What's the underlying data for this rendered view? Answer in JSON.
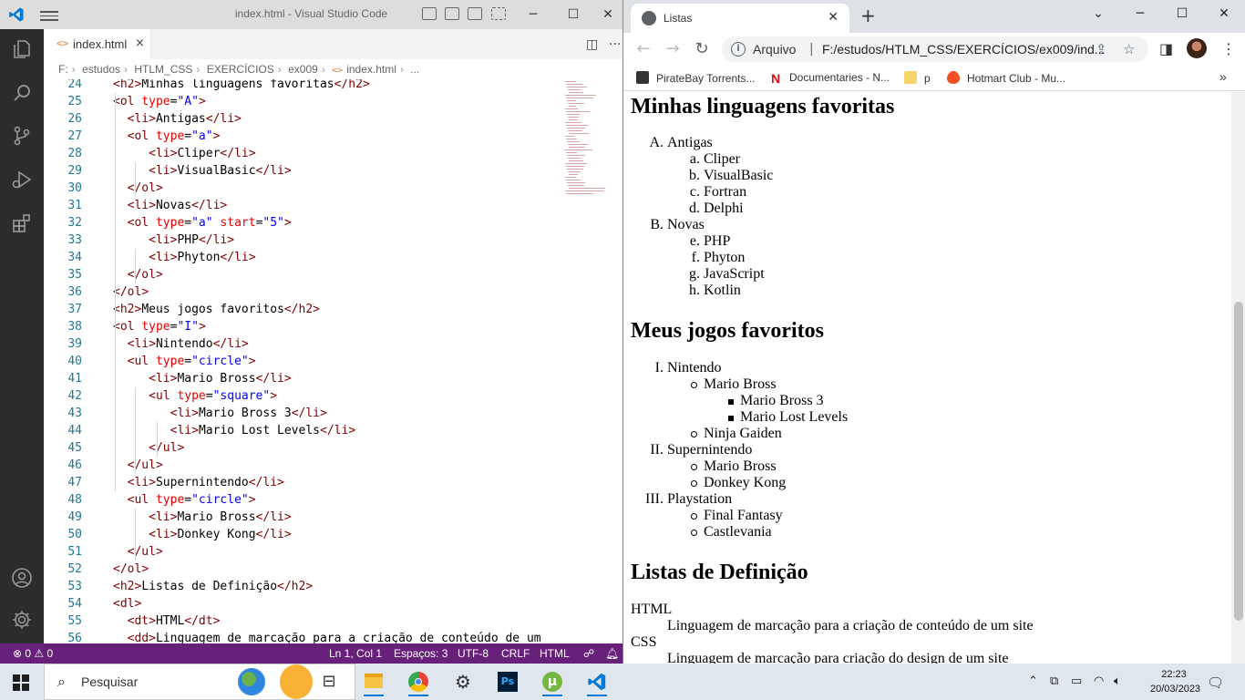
{
  "vscode": {
    "window_title": "index.html - Visual Studio Code",
    "tab": {
      "label": "index.html",
      "close": "×"
    },
    "breadcrumb": [
      "F:",
      "estudos",
      "HTLM_CSS",
      "EXERCÍCIOS",
      "ex009",
      "index.html",
      "..."
    ],
    "lines": [
      {
        "n": "24",
        "code": "<h2>Minhas linguagens favoritas</h2>"
      },
      {
        "n": "25",
        "code": "<ol type=\"A\">"
      },
      {
        "n": "26",
        "code": "  <li>Antigas</li>"
      },
      {
        "n": "27",
        "code": "  <ol type=\"a\">"
      },
      {
        "n": "28",
        "code": "     <li>Cliper</li>"
      },
      {
        "n": "29",
        "code": "     <li>VisualBasic</li>"
      },
      {
        "n": "30",
        "code": "  </ol>"
      },
      {
        "n": "31",
        "code": "  <li>Novas</li>"
      },
      {
        "n": "32",
        "code": "  <ol type=\"a\" start=\"5\">"
      },
      {
        "n": "33",
        "code": "     <li>PHP</li>"
      },
      {
        "n": "34",
        "code": "     <li>Phyton</li>"
      },
      {
        "n": "35",
        "code": "  </ol>"
      },
      {
        "n": "36",
        "code": "</ol>"
      },
      {
        "n": "37",
        "code": "<h2>Meus jogos favoritos</h2>"
      },
      {
        "n": "38",
        "code": "<ol type=\"I\">"
      },
      {
        "n": "39",
        "code": "  <li>Nintendo</li>"
      },
      {
        "n": "40",
        "code": "  <ul type=\"circle\">"
      },
      {
        "n": "41",
        "code": "     <li>Mario Bross</li>"
      },
      {
        "n": "42",
        "code": "     <ul type=\"square\">"
      },
      {
        "n": "43",
        "code": "        <li>Mario Bross 3</li>"
      },
      {
        "n": "44",
        "code": "        <li>Mario Lost Levels</li>"
      },
      {
        "n": "45",
        "code": "     </ul>"
      },
      {
        "n": "46",
        "code": "  </ul>"
      },
      {
        "n": "47",
        "code": "  <li>Supernintendo</li>"
      },
      {
        "n": "48",
        "code": "  <ul type=\"circle\">"
      },
      {
        "n": "49",
        "code": "     <li>Mario Bross</li>"
      },
      {
        "n": "50",
        "code": "     <li>Donkey Kong</li>"
      },
      {
        "n": "51",
        "code": "  </ul>"
      },
      {
        "n": "52",
        "code": "</ol>"
      },
      {
        "n": "53",
        "code": "<h2>Listas de Definição</h2>"
      },
      {
        "n": "54",
        "code": "<dl>"
      },
      {
        "n": "55",
        "code": "  <dt>HTML</dt>"
      },
      {
        "n": "56",
        "code": "  <dd>Linguagem de marcação para a criação de conteúdo de um"
      }
    ],
    "status": {
      "errors": "0",
      "warnings": "0",
      "position": "Ln 1, Col 1",
      "spaces": "Espaços: 3",
      "encoding": "UTF-8",
      "eol": "CRLF",
      "language": "HTML"
    },
    "colors": {
      "status_bar": "#68217a",
      "activity_bar": "#2c2c2c",
      "tag": "#800000",
      "attr": "#e50000",
      "value": "#0000ff"
    }
  },
  "chrome": {
    "tab_title": "Listas",
    "omnibox_label": "Arquivo",
    "url": "F:/estudos/HTLM_CSS/EXERCÍCIOS/ex009/ind...",
    "bookmarks": [
      {
        "label": "PirateBay Torrents...",
        "icon": "ship-icon"
      },
      {
        "label": "Documentaries - N...",
        "icon": "netflix-icon"
      },
      {
        "label": "p",
        "icon": "folder-icon"
      },
      {
        "label": "Hotmart Club - Mu...",
        "icon": "hotmart-icon"
      }
    ],
    "page": {
      "h_langs": "Minhas linguagens favoritas",
      "langs": [
        {
          "marker": "A.",
          "text": "Antigas",
          "level": 1
        },
        {
          "marker": "a.",
          "text": "Cliper",
          "level": 2
        },
        {
          "marker": "b.",
          "text": "VisualBasic",
          "level": 2
        },
        {
          "marker": "c.",
          "text": "Fortran",
          "level": 2
        },
        {
          "marker": "d.",
          "text": "Delphi",
          "level": 2
        },
        {
          "marker": "B.",
          "text": "Novas",
          "level": 1
        },
        {
          "marker": "e.",
          "text": "PHP",
          "level": 2
        },
        {
          "marker": "f.",
          "text": "Phyton",
          "level": 2
        },
        {
          "marker": "g.",
          "text": "JavaScript",
          "level": 2
        },
        {
          "marker": "h.",
          "text": "Kotlin",
          "level": 2
        }
      ],
      "h_games": "Meus jogos favoritos",
      "games": [
        {
          "marker": "I.",
          "text": "Nintendo",
          "level": 1
        },
        {
          "marker": "circle",
          "text": "Mario Bross",
          "level": 2
        },
        {
          "marker": "square",
          "text": "Mario Bross 3",
          "level": 3
        },
        {
          "marker": "square",
          "text": "Mario Lost Levels",
          "level": 3
        },
        {
          "marker": "circle",
          "text": "Ninja Gaiden",
          "level": 2
        },
        {
          "marker": "II.",
          "text": "Supernintendo",
          "level": 1
        },
        {
          "marker": "circle",
          "text": "Mario Bross",
          "level": 2
        },
        {
          "marker": "circle",
          "text": "Donkey Kong",
          "level": 2
        },
        {
          "marker": "III.",
          "text": "Playstation",
          "level": 1
        },
        {
          "marker": "circle",
          "text": "Final Fantasy",
          "level": 2
        },
        {
          "marker": "circle",
          "text": "Castlevania",
          "level": 2
        }
      ],
      "h_defs": "Listas de Definição",
      "defs": [
        {
          "term": "HTML",
          "desc": "Linguagem de marcação para a criação de conteúdo de um site"
        },
        {
          "term": "CSS",
          "desc": "Linguagem de marcação para criação do design de um site"
        }
      ]
    }
  },
  "taskbar": {
    "search_placeholder": "Pesquisar",
    "time": "22:23",
    "date": "20/03/2023",
    "apps": [
      "weather-icon",
      "task-view-icon",
      "file-explorer-icon",
      "chrome-icon",
      "settings-icon",
      "photoshop-icon",
      "utorrent-icon",
      "vscode-icon"
    ],
    "colors": {
      "background": "#dfe6ee",
      "active_indicator": "#0078d4"
    }
  }
}
